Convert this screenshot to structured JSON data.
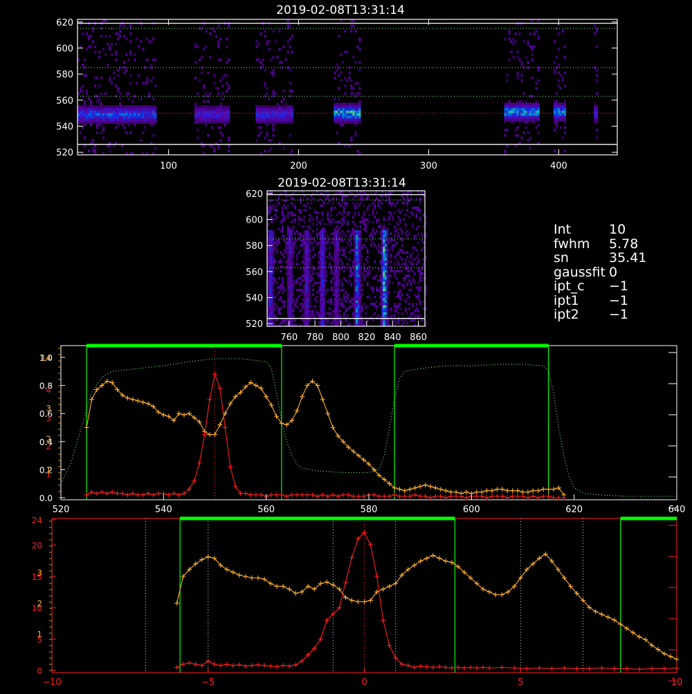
{
  "titles": {
    "top": "2019-02-08T13:31:14",
    "mid": "2019-02-08T13:31:14"
  },
  "stats": [
    {
      "key": "Int",
      "value": "10"
    },
    {
      "key": "fwhm",
      "value": "5.78"
    },
    {
      "key": "sn",
      "value": "35.41"
    },
    {
      "key": "gaussfit",
      "value": "0"
    },
    {
      "key": "ipt_c",
      "value": "−1"
    },
    {
      "key": "ipt1",
      "value": "−1"
    },
    {
      "key": "ipt2",
      "value": "−1"
    }
  ],
  "colors": {
    "axis": "#ffffff",
    "red": "#ff2020",
    "orange": "#ffb030",
    "green": "#00ff00",
    "dotted_gray": "#aaaaaa",
    "dotted_green": "#7fff7f"
  },
  "chart_data": [
    {
      "type": "heatmap",
      "title": "2019-02-08T13:31:14",
      "xlim": [
        30,
        445
      ],
      "ylim": [
        518,
        622
      ],
      "xticks": [
        "100",
        "200",
        "300",
        "400"
      ],
      "xtick_values": [
        100,
        200,
        300,
        400
      ],
      "yticks": [
        "520",
        "540",
        "560",
        "580",
        "600",
        "620"
      ],
      "ytick_values": [
        520,
        540,
        560,
        580,
        600,
        620
      ],
      "hlines_dotted": [
        615,
        585,
        563,
        550
      ],
      "hlines_solid": [
        619,
        526
      ],
      "bands": [
        {
          "x": [
            30,
            90
          ],
          "peak": 548,
          "intensity": 0.6
        },
        {
          "x": [
            120,
            147
          ],
          "peak": 548,
          "intensity": 0.45
        },
        {
          "x": [
            167,
            195
          ],
          "peak": 548,
          "intensity": 0.5
        },
        {
          "x": [
            227,
            247
          ],
          "peak": 549,
          "intensity": 0.85
        },
        {
          "x": [
            358,
            385
          ],
          "peak": 550,
          "intensity": 0.75
        },
        {
          "x": [
            396,
            405
          ],
          "peak": 550,
          "intensity": 0.7
        },
        {
          "x": [
            427,
            430
          ],
          "peak": 549,
          "intensity": 0.5
        }
      ]
    },
    {
      "type": "heatmap",
      "title": "2019-02-08T13:31:14",
      "xlim": [
        743,
        865
      ],
      "ylim": [
        518,
        622
      ],
      "xticks": [
        "760",
        "780",
        "800",
        "820",
        "840",
        "860"
      ],
      "xtick_values": [
        760,
        780,
        800,
        820,
        840,
        860
      ],
      "yticks": [
        "520",
        "540",
        "560",
        "580",
        "600",
        "620"
      ],
      "ytick_values": [
        520,
        540,
        560,
        580,
        600,
        620
      ],
      "hlines_dotted": [
        615,
        585,
        563
      ],
      "hlines_solid": [
        619,
        524
      ],
      "stripes": [
        {
          "x": 745,
          "intensity": 0.55
        },
        {
          "x": 760,
          "intensity": 0.4
        },
        {
          "x": 773,
          "intensity": 0.45
        },
        {
          "x": 785,
          "intensity": 0.5
        },
        {
          "x": 796,
          "intensity": 0.35
        },
        {
          "x": 812,
          "intensity": 0.75
        },
        {
          "x": 833,
          "intensity": 0.95
        }
      ]
    },
    {
      "type": "line",
      "xlim": [
        520,
        640
      ],
      "xticks": [
        "520",
        "540",
        "560",
        "580",
        "600",
        "620",
        "640"
      ],
      "xtick_values": [
        520,
        540,
        560,
        580,
        600,
        620,
        640
      ],
      "yticks_left_white": [
        "0.0",
        "0.2",
        "0.4",
        "0.6",
        "0.8",
        "1.0"
      ],
      "yticks_left_red": [
        "1",
        "2",
        "3",
        "4"
      ],
      "yticks_left_orange": [
        "1",
        "2",
        "3",
        "14"
      ],
      "green_spans": [
        [
          525,
          563
        ],
        [
          585,
          615
        ]
      ],
      "vline_dotted": 550,
      "series": [
        {
          "color": "red",
          "x": [
            525,
            526,
            527,
            528,
            529,
            530,
            531,
            532,
            533,
            534,
            535,
            536,
            537,
            538,
            539,
            540,
            541,
            542,
            543,
            544,
            545,
            546,
            547,
            548,
            549,
            550,
            551,
            552,
            553,
            554,
            555,
            556,
            557,
            558,
            559,
            560,
            561,
            562,
            563,
            564,
            565,
            566,
            567,
            568,
            569,
            570,
            571,
            572,
            573,
            574,
            575,
            576,
            577,
            578,
            579,
            580,
            581,
            582,
            583,
            584,
            585,
            586,
            587,
            588,
            589,
            590,
            591,
            592,
            593,
            594,
            595,
            596,
            597,
            598,
            599,
            600,
            601,
            602,
            603,
            604,
            605,
            606,
            607,
            608,
            609,
            610,
            611,
            612,
            613,
            614,
            615,
            616,
            617,
            618
          ],
          "y": [
            0.02,
            0.04,
            0.03,
            0.04,
            0.03,
            0.04,
            0.03,
            0.03,
            0.02,
            0.03,
            0.02,
            0.02,
            0.03,
            0.02,
            0.03,
            0.03,
            0.02,
            0.03,
            0.02,
            0.03,
            0.06,
            0.12,
            0.25,
            0.45,
            0.7,
            0.88,
            0.78,
            0.5,
            0.22,
            0.08,
            0.03,
            0.03,
            0.02,
            0.02,
            0.02,
            0.01,
            0.02,
            0.02,
            0.02,
            0.01,
            0.02,
            0.02,
            0.02,
            0.02,
            0.02,
            0.01,
            0.02,
            0.01,
            0.02,
            0.01,
            0.02,
            0.02,
            0.01,
            0.01,
            0.01,
            0.02,
            0.02,
            0.01,
            0.01,
            0.01,
            0.02,
            0.01,
            0.01,
            0.01,
            0.02,
            0.01,
            0.01,
            0.0,
            0.01,
            0.01,
            0.0,
            0.01,
            0.01,
            0.01,
            0.0,
            0.01,
            0.01,
            0.01,
            0.0,
            0.01,
            0.01,
            0.01,
            0.0,
            0.01,
            0.01,
            0.01,
            0.0,
            0.01,
            0.0,
            0.01,
            0.01,
            0.0,
            0.0,
            0.0
          ]
        },
        {
          "color": "orange",
          "x": [
            525,
            526,
            527,
            528,
            529,
            530,
            531,
            532,
            533,
            534,
            535,
            536,
            537,
            538,
            539,
            540,
            541,
            542,
            543,
            544,
            545,
            546,
            547,
            548,
            549,
            550,
            551,
            552,
            553,
            554,
            555,
            556,
            557,
            558,
            559,
            560,
            561,
            562,
            563,
            564,
            565,
            566,
            567,
            568,
            569,
            570,
            571,
            572,
            573,
            574,
            575,
            576,
            577,
            578,
            579,
            580,
            581,
            582,
            583,
            584,
            585,
            586,
            587,
            588,
            589,
            590,
            591,
            592,
            593,
            594,
            595,
            596,
            597,
            598,
            599,
            600,
            601,
            602,
            603,
            604,
            605,
            606,
            607,
            608,
            609,
            610,
            611,
            612,
            613,
            614,
            615,
            616,
            617,
            618
          ],
          "y": [
            0.5,
            0.7,
            0.77,
            0.8,
            0.83,
            0.82,
            0.77,
            0.73,
            0.71,
            0.7,
            0.69,
            0.68,
            0.67,
            0.65,
            0.61,
            0.59,
            0.58,
            0.55,
            0.6,
            0.59,
            0.6,
            0.57,
            0.54,
            0.47,
            0.45,
            0.45,
            0.52,
            0.6,
            0.67,
            0.72,
            0.75,
            0.79,
            0.82,
            0.8,
            0.78,
            0.72,
            0.66,
            0.58,
            0.53,
            0.52,
            0.55,
            0.62,
            0.72,
            0.8,
            0.83,
            0.8,
            0.7,
            0.6,
            0.5,
            0.44,
            0.4,
            0.36,
            0.33,
            0.3,
            0.27,
            0.24,
            0.2,
            0.16,
            0.13,
            0.1,
            0.07,
            0.06,
            0.05,
            0.06,
            0.07,
            0.08,
            0.09,
            0.08,
            0.07,
            0.06,
            0.05,
            0.04,
            0.04,
            0.03,
            0.04,
            0.03,
            0.04,
            0.04,
            0.05,
            0.05,
            0.06,
            0.06,
            0.05,
            0.05,
            0.05,
            0.04,
            0.04,
            0.05,
            0.05,
            0.06,
            0.06,
            0.06,
            0.07,
            0.02
          ]
        },
        {
          "color": "dotted_green",
          "x": [
            520,
            522,
            524,
            526,
            528,
            530,
            535,
            540,
            545,
            550,
            555,
            560,
            561,
            562,
            563,
            564,
            565,
            566,
            567,
            570,
            575,
            580,
            582,
            583,
            584,
            585,
            586,
            587,
            590,
            595,
            600,
            605,
            610,
            614,
            615,
            616,
            617,
            618,
            619,
            620,
            622,
            625,
            630,
            635,
            640
          ],
          "y": [
            0.1,
            0.25,
            0.5,
            0.75,
            0.86,
            0.9,
            0.92,
            0.94,
            0.97,
            0.99,
            0.99,
            0.97,
            0.92,
            0.75,
            0.55,
            0.4,
            0.3,
            0.24,
            0.21,
            0.19,
            0.18,
            0.18,
            0.2,
            0.3,
            0.5,
            0.7,
            0.85,
            0.9,
            0.92,
            0.94,
            0.94,
            0.95,
            0.95,
            0.94,
            0.9,
            0.75,
            0.5,
            0.3,
            0.15,
            0.07,
            0.03,
            0.02,
            0.01,
            0.01,
            0.01
          ]
        }
      ]
    },
    {
      "type": "line",
      "xlim": [
        -10,
        10
      ],
      "xticks": [
        "−10",
        "−5",
        "0",
        "5",
        "10"
      ],
      "xtick_values": [
        -10,
        -5,
        0,
        5,
        10
      ],
      "yticks_left_red": [
        "0",
        "5",
        "10",
        "15",
        "20",
        "24"
      ],
      "yticks_left_orange": [
        "1",
        "2",
        "3"
      ],
      "green_spans": [
        [
          -5.9,
          2.9
        ],
        [
          8.2,
          10
        ]
      ],
      "vlines_dotted": [
        -7,
        -5,
        -1,
        0,
        1,
        5,
        7
      ],
      "series": [
        {
          "color": "red",
          "x": [
            -6,
            -5.8,
            -5.6,
            -5.4,
            -5.2,
            -5,
            -4.8,
            -4.6,
            -4.4,
            -4.2,
            -4,
            -3.8,
            -3.6,
            -3.4,
            -3.2,
            -3,
            -2.8,
            -2.6,
            -2.4,
            -2.2,
            -2,
            -1.8,
            -1.6,
            -1.4,
            -1.2,
            -1,
            -0.8,
            -0.6,
            -0.4,
            -0.2,
            0,
            0.2,
            0.4,
            0.6,
            0.8,
            1,
            1.2,
            1.4,
            1.6,
            1.8,
            2,
            2.2,
            2.4,
            2.6,
            2.8,
            3,
            3.2,
            3.4,
            3.6,
            3.8,
            4,
            4.4,
            4.8,
            5.2,
            5.6,
            6,
            6.4,
            6.8,
            7.2,
            7.6,
            8,
            8.4,
            8.8,
            9.2,
            9.6,
            10
          ],
          "y": [
            0.5,
            1,
            1.2,
            1,
            0.8,
            1.5,
            1,
            0.8,
            1,
            0.8,
            0.9,
            0.7,
            0.8,
            0.9,
            0.8,
            0.7,
            0.6,
            0.8,
            0.7,
            0.9,
            1.5,
            2.5,
            3.5,
            5,
            8,
            9,
            10,
            14,
            18,
            21,
            22,
            20,
            15,
            8,
            4,
            2,
            1,
            0.8,
            0.5,
            0.7,
            0.6,
            0.5,
            0.6,
            0.5,
            0.4,
            0.5,
            0.4,
            0.5,
            0.4,
            0.5,
            0.4,
            0.5,
            0.4,
            0.3,
            0.4,
            0.3,
            0.4,
            0.3,
            0.3,
            0.4,
            0.3,
            0.3,
            0.2,
            0.3,
            0.3,
            0.4
          ]
        },
        {
          "color": "orange",
          "x": [
            -6,
            -5.8,
            -5.6,
            -5.4,
            -5.2,
            -5,
            -4.8,
            -4.6,
            -4.4,
            -4.2,
            -4,
            -3.8,
            -3.6,
            -3.4,
            -3.2,
            -3,
            -2.8,
            -2.6,
            -2.4,
            -2.2,
            -2,
            -1.8,
            -1.6,
            -1.4,
            -1.2,
            -1,
            -0.8,
            -0.6,
            -0.4,
            -0.2,
            0,
            0.2,
            0.4,
            0.6,
            0.8,
            1,
            1.2,
            1.4,
            1.6,
            1.8,
            2,
            2.2,
            2.4,
            2.6,
            2.8,
            3,
            3.2,
            3.4,
            3.6,
            3.8,
            4,
            4.2,
            4.4,
            4.6,
            4.8,
            5,
            5.2,
            5.4,
            5.6,
            5.8,
            6,
            6.2,
            6.4,
            6.6,
            6.8,
            7,
            7.2,
            7.4,
            7.6,
            7.8,
            8,
            8.2,
            8.4,
            8.6,
            8.8,
            9,
            9.2,
            9.4,
            9.6,
            9.8,
            10
          ],
          "y": [
            0.48,
            0.67,
            0.72,
            0.76,
            0.79,
            0.81,
            0.8,
            0.75,
            0.72,
            0.7,
            0.68,
            0.67,
            0.66,
            0.66,
            0.65,
            0.62,
            0.6,
            0.6,
            0.58,
            0.55,
            0.56,
            0.6,
            0.58,
            0.62,
            0.63,
            0.61,
            0.58,
            0.52,
            0.5,
            0.49,
            0.49,
            0.5,
            0.56,
            0.58,
            0.6,
            0.62,
            0.68,
            0.72,
            0.75,
            0.78,
            0.8,
            0.82,
            0.8,
            0.78,
            0.77,
            0.74,
            0.7,
            0.66,
            0.62,
            0.58,
            0.56,
            0.54,
            0.54,
            0.56,
            0.6,
            0.66,
            0.72,
            0.76,
            0.8,
            0.83,
            0.78,
            0.72,
            0.66,
            0.6,
            0.55,
            0.5,
            0.45,
            0.42,
            0.4,
            0.38,
            0.36,
            0.33,
            0.3,
            0.27,
            0.24,
            0.22,
            0.18,
            0.15,
            0.12,
            0.1,
            0.08
          ]
        }
      ]
    }
  ]
}
